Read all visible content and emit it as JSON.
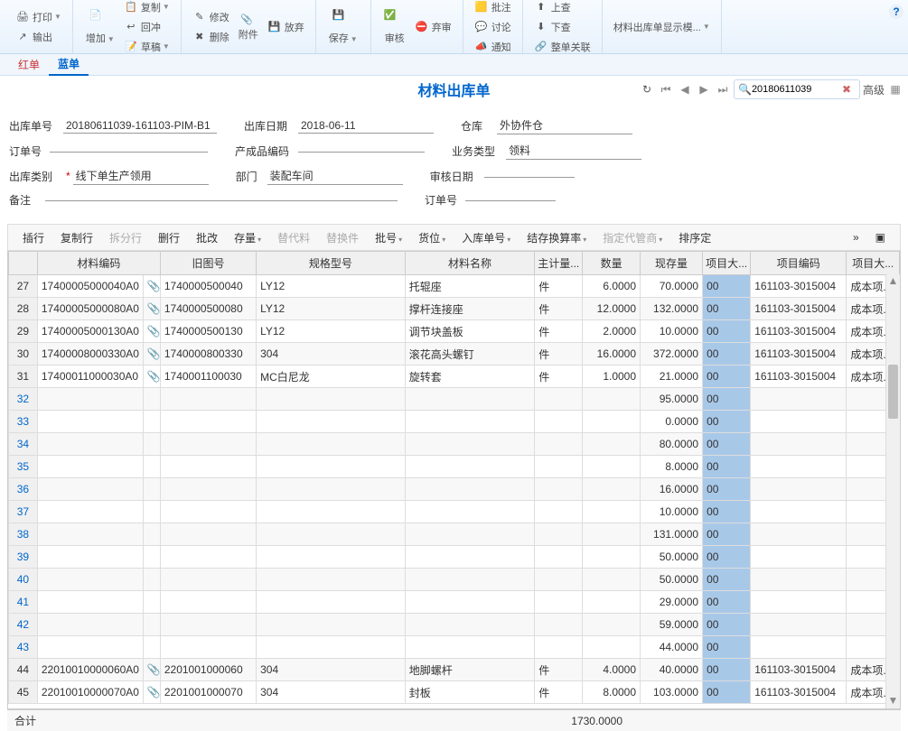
{
  "ribbon": {
    "print": "打印",
    "export": "输出",
    "add": "增加",
    "copy": "复制",
    "reverse": "回冲",
    "draft": "草稿",
    "modify": "修改",
    "delete": "删除",
    "attach": "附件",
    "abandon": "放弃",
    "save": "保存",
    "audit": "审核",
    "discard": "弃审",
    "approve": "批注",
    "discuss": "讨论",
    "notify": "通知",
    "check": "上查",
    "trace": "下查",
    "related": "整单关联",
    "template": "材料出库单显示模..."
  },
  "tabs": {
    "red": "红单",
    "blue": "蓝单"
  },
  "title": "材料出库单",
  "search": {
    "value": "20180611039",
    "advanced": "高级"
  },
  "form": {
    "doc_no_label": "出库单号",
    "doc_no": "20180611039-161103-PIM-B1",
    "date_label": "出库日期",
    "date": "2018-06-11",
    "warehouse_label": "仓库",
    "warehouse": "外协件仓",
    "order_label": "订单号",
    "product_label": "产成品编码",
    "biz_type_label": "业务类型",
    "biz_type": "领料",
    "category_label": "出库类别",
    "category": "线下单生产领用",
    "dept_label": "部门",
    "dept": "装配车间",
    "audit_date_label": "审核日期",
    "remark_label": "备注",
    "order_no_label": "订单号"
  },
  "grid_toolbar": {
    "insert": "插行",
    "copy_row": "复制行",
    "split_row": "拆分行",
    "delete_row": "删行",
    "batch_mod": "批改",
    "stock": "存量",
    "substitute": "替代料",
    "replace": "替换件",
    "batch": "批号",
    "location": "货位",
    "inbound": "入库单号",
    "rate": "结存换算率",
    "supplier": "指定代管商",
    "sort": "排序定"
  },
  "columns": {
    "material_code": "材料编码",
    "old_code": "旧图号",
    "spec": "规格型号",
    "material_name": "材料名称",
    "unit_group": "主计量...",
    "qty": "数量",
    "stock_qty": "现存量",
    "proj_big": "项目大...",
    "proj_code": "项目编码",
    "proj_big2": "项目大..."
  },
  "rows": [
    {
      "n": 27,
      "code": "17400005000040A0",
      "att": "📎",
      "old": "1740000500040",
      "spec": "LY12",
      "name": "托辊座",
      "unit": "件",
      "qty": "6.0000",
      "stock": "70.0000",
      "pb": "00",
      "pc": "161103-3015004",
      "pn": "成本项..."
    },
    {
      "n": 28,
      "code": "17400005000080A0",
      "att": "📎",
      "old": "1740000500080",
      "spec": "LY12",
      "name": "撑杆连接座",
      "unit": "件",
      "qty": "12.0000",
      "stock": "132.0000",
      "pb": "00",
      "pc": "161103-3015004",
      "pn": "成本项..."
    },
    {
      "n": 29,
      "code": "17400005000130A0",
      "att": "📎",
      "old": "1740000500130",
      "spec": "LY12",
      "name": "调节块盖板",
      "unit": "件",
      "qty": "2.0000",
      "stock": "10.0000",
      "pb": "00",
      "pc": "161103-3015004",
      "pn": "成本项..."
    },
    {
      "n": 30,
      "code": "17400008000330A0",
      "att": "📎",
      "old": "1740000800330",
      "spec": "304",
      "name": "滚花高头螺钉",
      "unit": "件",
      "qty": "16.0000",
      "stock": "372.0000",
      "pb": "00",
      "pc": "161103-3015004",
      "pn": "成本项..."
    },
    {
      "n": 31,
      "code": "17400011000030A0",
      "att": "📎",
      "old": "1740001100030",
      "spec": "MC白尼龙",
      "name": "旋转套",
      "unit": "件",
      "qty": "1.0000",
      "stock": "21.0000",
      "pb": "00",
      "pc": "161103-3015004",
      "pn": "成本项..."
    },
    {
      "n": 32,
      "code": "",
      "att": "",
      "old": "",
      "spec": "",
      "name": "",
      "unit": "",
      "qty": "",
      "stock": "95.0000",
      "pb": "00",
      "pc": "",
      "pn": ""
    },
    {
      "n": 33,
      "code": "",
      "att": "",
      "old": "",
      "spec": "",
      "name": "",
      "unit": "",
      "qty": "",
      "stock": "0.0000",
      "pb": "00",
      "pc": "",
      "pn": ""
    },
    {
      "n": 34,
      "code": "",
      "att": "",
      "old": "",
      "spec": "",
      "name": "",
      "unit": "",
      "qty": "",
      "stock": "80.0000",
      "pb": "00",
      "pc": "",
      "pn": ""
    },
    {
      "n": 35,
      "code": "",
      "att": "",
      "old": "",
      "spec": "",
      "name": "",
      "unit": "",
      "qty": "",
      "stock": "8.0000",
      "pb": "00",
      "pc": "",
      "pn": ""
    },
    {
      "n": 36,
      "code": "",
      "att": "",
      "old": "",
      "spec": "",
      "name": "",
      "unit": "",
      "qty": "",
      "stock": "16.0000",
      "pb": "00",
      "pc": "",
      "pn": ""
    },
    {
      "n": 37,
      "code": "",
      "att": "",
      "old": "",
      "spec": "",
      "name": "",
      "unit": "",
      "qty": "",
      "stock": "10.0000",
      "pb": "00",
      "pc": "",
      "pn": ""
    },
    {
      "n": 38,
      "code": "",
      "att": "",
      "old": "",
      "spec": "",
      "name": "",
      "unit": "",
      "qty": "",
      "stock": "131.0000",
      "pb": "00",
      "pc": "",
      "pn": ""
    },
    {
      "n": 39,
      "code": "",
      "att": "",
      "old": "",
      "spec": "",
      "name": "",
      "unit": "",
      "qty": "",
      "stock": "50.0000",
      "pb": "00",
      "pc": "",
      "pn": ""
    },
    {
      "n": 40,
      "code": "",
      "att": "",
      "old": "",
      "spec": "",
      "name": "",
      "unit": "",
      "qty": "",
      "stock": "50.0000",
      "pb": "00",
      "pc": "",
      "pn": ""
    },
    {
      "n": 41,
      "code": "",
      "att": "",
      "old": "",
      "spec": "",
      "name": "",
      "unit": "",
      "qty": "",
      "stock": "29.0000",
      "pb": "00",
      "pc": "",
      "pn": ""
    },
    {
      "n": 42,
      "code": "",
      "att": "",
      "old": "",
      "spec": "",
      "name": "",
      "unit": "",
      "qty": "",
      "stock": "59.0000",
      "pb": "00",
      "pc": "",
      "pn": ""
    },
    {
      "n": 43,
      "code": "",
      "att": "",
      "old": "",
      "spec": "",
      "name": "",
      "unit": "",
      "qty": "",
      "stock": "44.0000",
      "pb": "00",
      "pc": "",
      "pn": ""
    },
    {
      "n": 44,
      "code": "22010010000060A0",
      "att": "📎",
      "old": "2201001000060",
      "spec": "304",
      "name": "地脚螺杆",
      "unit": "件",
      "qty": "4.0000",
      "stock": "40.0000",
      "pb": "00",
      "pc": "161103-3015004",
      "pn": "成本项..."
    },
    {
      "n": 45,
      "code": "22010010000070A0",
      "att": "📎",
      "old": "2201001000070",
      "spec": "304",
      "name": "封板",
      "unit": "件",
      "qty": "8.0000",
      "stock": "103.0000",
      "pb": "00",
      "pc": "161103-3015004",
      "pn": "成本项..."
    }
  ],
  "footer": {
    "total_label": "合计",
    "total_qty": "1730.0000"
  }
}
